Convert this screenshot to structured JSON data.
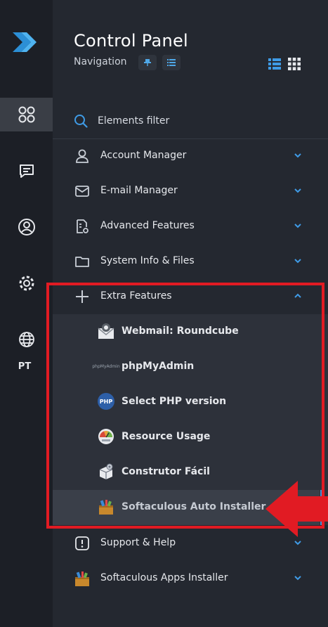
{
  "header": {
    "title": "Control Panel",
    "subtitle": "Navigation"
  },
  "filter": {
    "label": "Elements filter"
  },
  "rail": {
    "language": "PT"
  },
  "menu": {
    "account_manager": "Account Manager",
    "email_manager": "E-mail Manager",
    "advanced_features": "Advanced Features",
    "system_info": "System Info & Files",
    "extra_features": "Extra Features",
    "support_help": "Support & Help",
    "softaculous_apps": "Softaculous Apps Installer"
  },
  "extra_items": {
    "webmail": "Webmail: Roundcube",
    "phpmyadmin": "phpMyAdmin",
    "php_version": "Select PHP version",
    "resource_usage": "Resource Usage",
    "construtor": "Construtor Fácil",
    "softaculous": "Softaculous Auto Installer"
  },
  "icon_text": {
    "phpmyadmin_logo": "phpMyAdmin",
    "php_badge": "PHP"
  },
  "colors": {
    "accent_blue": "#3f8fd6",
    "highlight_red": "#e11b23",
    "panel_bg": "#242830",
    "rail_bg": "#1c1f26"
  }
}
